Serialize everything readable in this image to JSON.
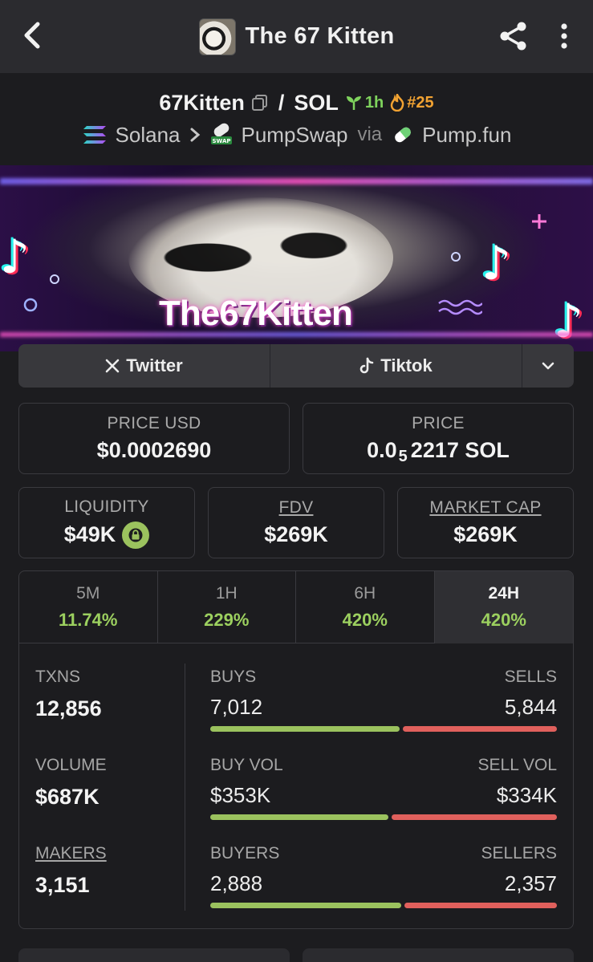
{
  "header": {
    "title": "The 67 Kitten",
    "back_icon": "chevron-left-icon",
    "share_icon": "share-icon",
    "more_icon": "more-vertical-icon"
  },
  "pair": {
    "token": "67Kitten",
    "separator": "/",
    "quote": "SOL",
    "age": "1h",
    "rank": "#25",
    "chain": "Solana",
    "dex": "PumpSwap",
    "via": "via",
    "launchpad": "Pump.fun"
  },
  "banner": {
    "text": "The67Kitten"
  },
  "socials": {
    "twitter": "Twitter",
    "tiktok": "Tiktok"
  },
  "stats": {
    "price_usd_label": "PRICE USD",
    "price_usd": "$0.0002690",
    "price_label": "PRICE",
    "price_sol_prefix": "0.0",
    "price_sol_sub": "5",
    "price_sol_rest": "2217 SOL",
    "liquidity_label": "LIQUIDITY",
    "liquidity": "$49K",
    "fdv_label": "FDV",
    "fdv": "$269K",
    "mcap_label": "MARKET CAP",
    "mcap": "$269K"
  },
  "tabs": [
    {
      "label": "5M",
      "value": "11.74%"
    },
    {
      "label": "1H",
      "value": "229%"
    },
    {
      "label": "6H",
      "value": "420%"
    },
    {
      "label": "24H",
      "value": "420%"
    }
  ],
  "metrics": {
    "txns_label": "TXNS",
    "txns": "12,856",
    "buys_label": "BUYS",
    "buys": "7,012",
    "sells_label": "SELLS",
    "sells": "5,844",
    "volume_label": "VOLUME",
    "volume": "$687K",
    "buy_vol_label": "BUY VOL",
    "buy_vol": "$353K",
    "sell_vol_label": "SELL VOL",
    "sell_vol": "$334K",
    "makers_label": "MAKERS",
    "makers": "3,151",
    "buyers_label": "BUYERS",
    "buyers": "2,888",
    "sellers_label": "SELLERS",
    "sellers": "2,357"
  },
  "colors": {
    "positive": "#9cd05f",
    "buy_bar": "#9bc25e",
    "sell_bar": "#e0605c",
    "age_badge": "#7fd35d",
    "rank_badge": "#f1a232"
  }
}
